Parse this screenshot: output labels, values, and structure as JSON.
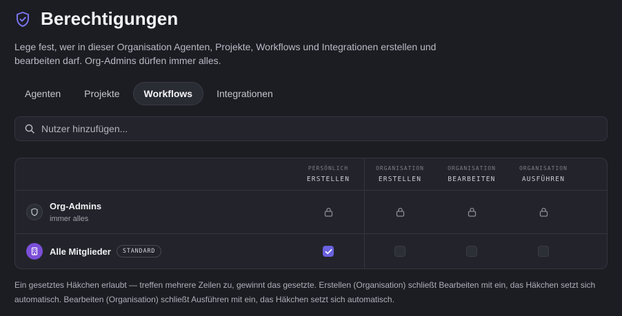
{
  "header": {
    "icon": "shield-check-icon",
    "title": "Berechtigungen",
    "description": "Lege fest, wer in dieser Organisation Agenten, Projekte, Workflows und Integrationen erstellen und bearbeiten darf. Org-Admins dürfen immer alles."
  },
  "tabs": [
    {
      "label": "Agenten",
      "active": false
    },
    {
      "label": "Projekte",
      "active": false
    },
    {
      "label": "Workflows",
      "active": true
    },
    {
      "label": "Integrationen",
      "active": false
    }
  ],
  "search": {
    "icon": "search-icon",
    "placeholder": "Nutzer hinzufügen..."
  },
  "table": {
    "columns": [
      {
        "scope": "PERSÖNLICH",
        "action": "ERSTELLEN"
      },
      {
        "scope": "ORGANISATION",
        "action": "ERSTELLEN"
      },
      {
        "scope": "ORGANISATION",
        "action": "BEARBEITEN"
      },
      {
        "scope": "ORGANISATION",
        "action": "AUSFÜHREN"
      }
    ],
    "rows": [
      {
        "name": "Org-Admins",
        "subtitle": "immer alles",
        "avatar_icon": "shield-icon",
        "cells": [
          "locked",
          "locked",
          "locked",
          "locked"
        ]
      },
      {
        "name": "Alle Mitglieder",
        "badge": "STANDARD",
        "avatar_icon": "building-icon",
        "cells": [
          "checked",
          "unchecked",
          "unchecked",
          "unchecked"
        ]
      }
    ]
  },
  "footer": "Ein gesetztes Häkchen erlaubt — treffen mehrere Zeilen zu, gewinnt das gesetzte. Erstellen (Organisation) schließt Bearbeiten mit ein, das Häkchen setzt sich automatisch. Bearbeiten (Organisation) schließt Ausführen mit ein, das Häkchen setzt sich automatisch.",
  "colors": {
    "background": "#1c1d23",
    "accent": "#6a62e0",
    "members_avatar": "#7b4fd8"
  }
}
